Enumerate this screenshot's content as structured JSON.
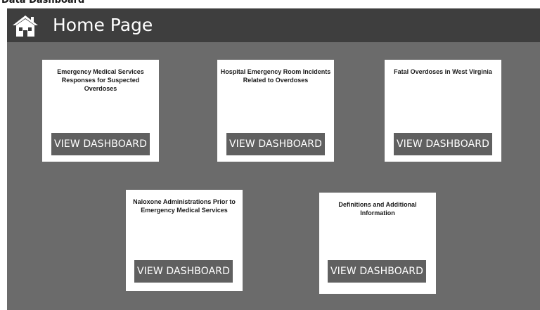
{
  "page": {
    "title": "Data Dashboard"
  },
  "header": {
    "title": "Home Page",
    "icon": "home-icon"
  },
  "colors": {
    "background": "#6b6b6b",
    "header": "#3e3e3e",
    "card": "#ffffff",
    "button": "#606060",
    "button_text": "#ffffff"
  },
  "cards": [
    {
      "title": "Emergency Medical Services Responses for Suspected Overdoses",
      "button_label": "VIEW DASHBOARD"
    },
    {
      "title": "Hospital Emergency Room Incidents Related to Overdoses",
      "button_label": "VIEW DASHBOARD"
    },
    {
      "title": "Fatal Overdoses in West Virginia",
      "button_label": "VIEW DASHBOARD"
    },
    {
      "title": "Naloxone Administrations Prior to Emergency Medical Services",
      "button_label": "VIEW DASHBOARD"
    },
    {
      "title": "Definitions and Additional Information",
      "button_label": "VIEW DASHBOARD"
    }
  ]
}
